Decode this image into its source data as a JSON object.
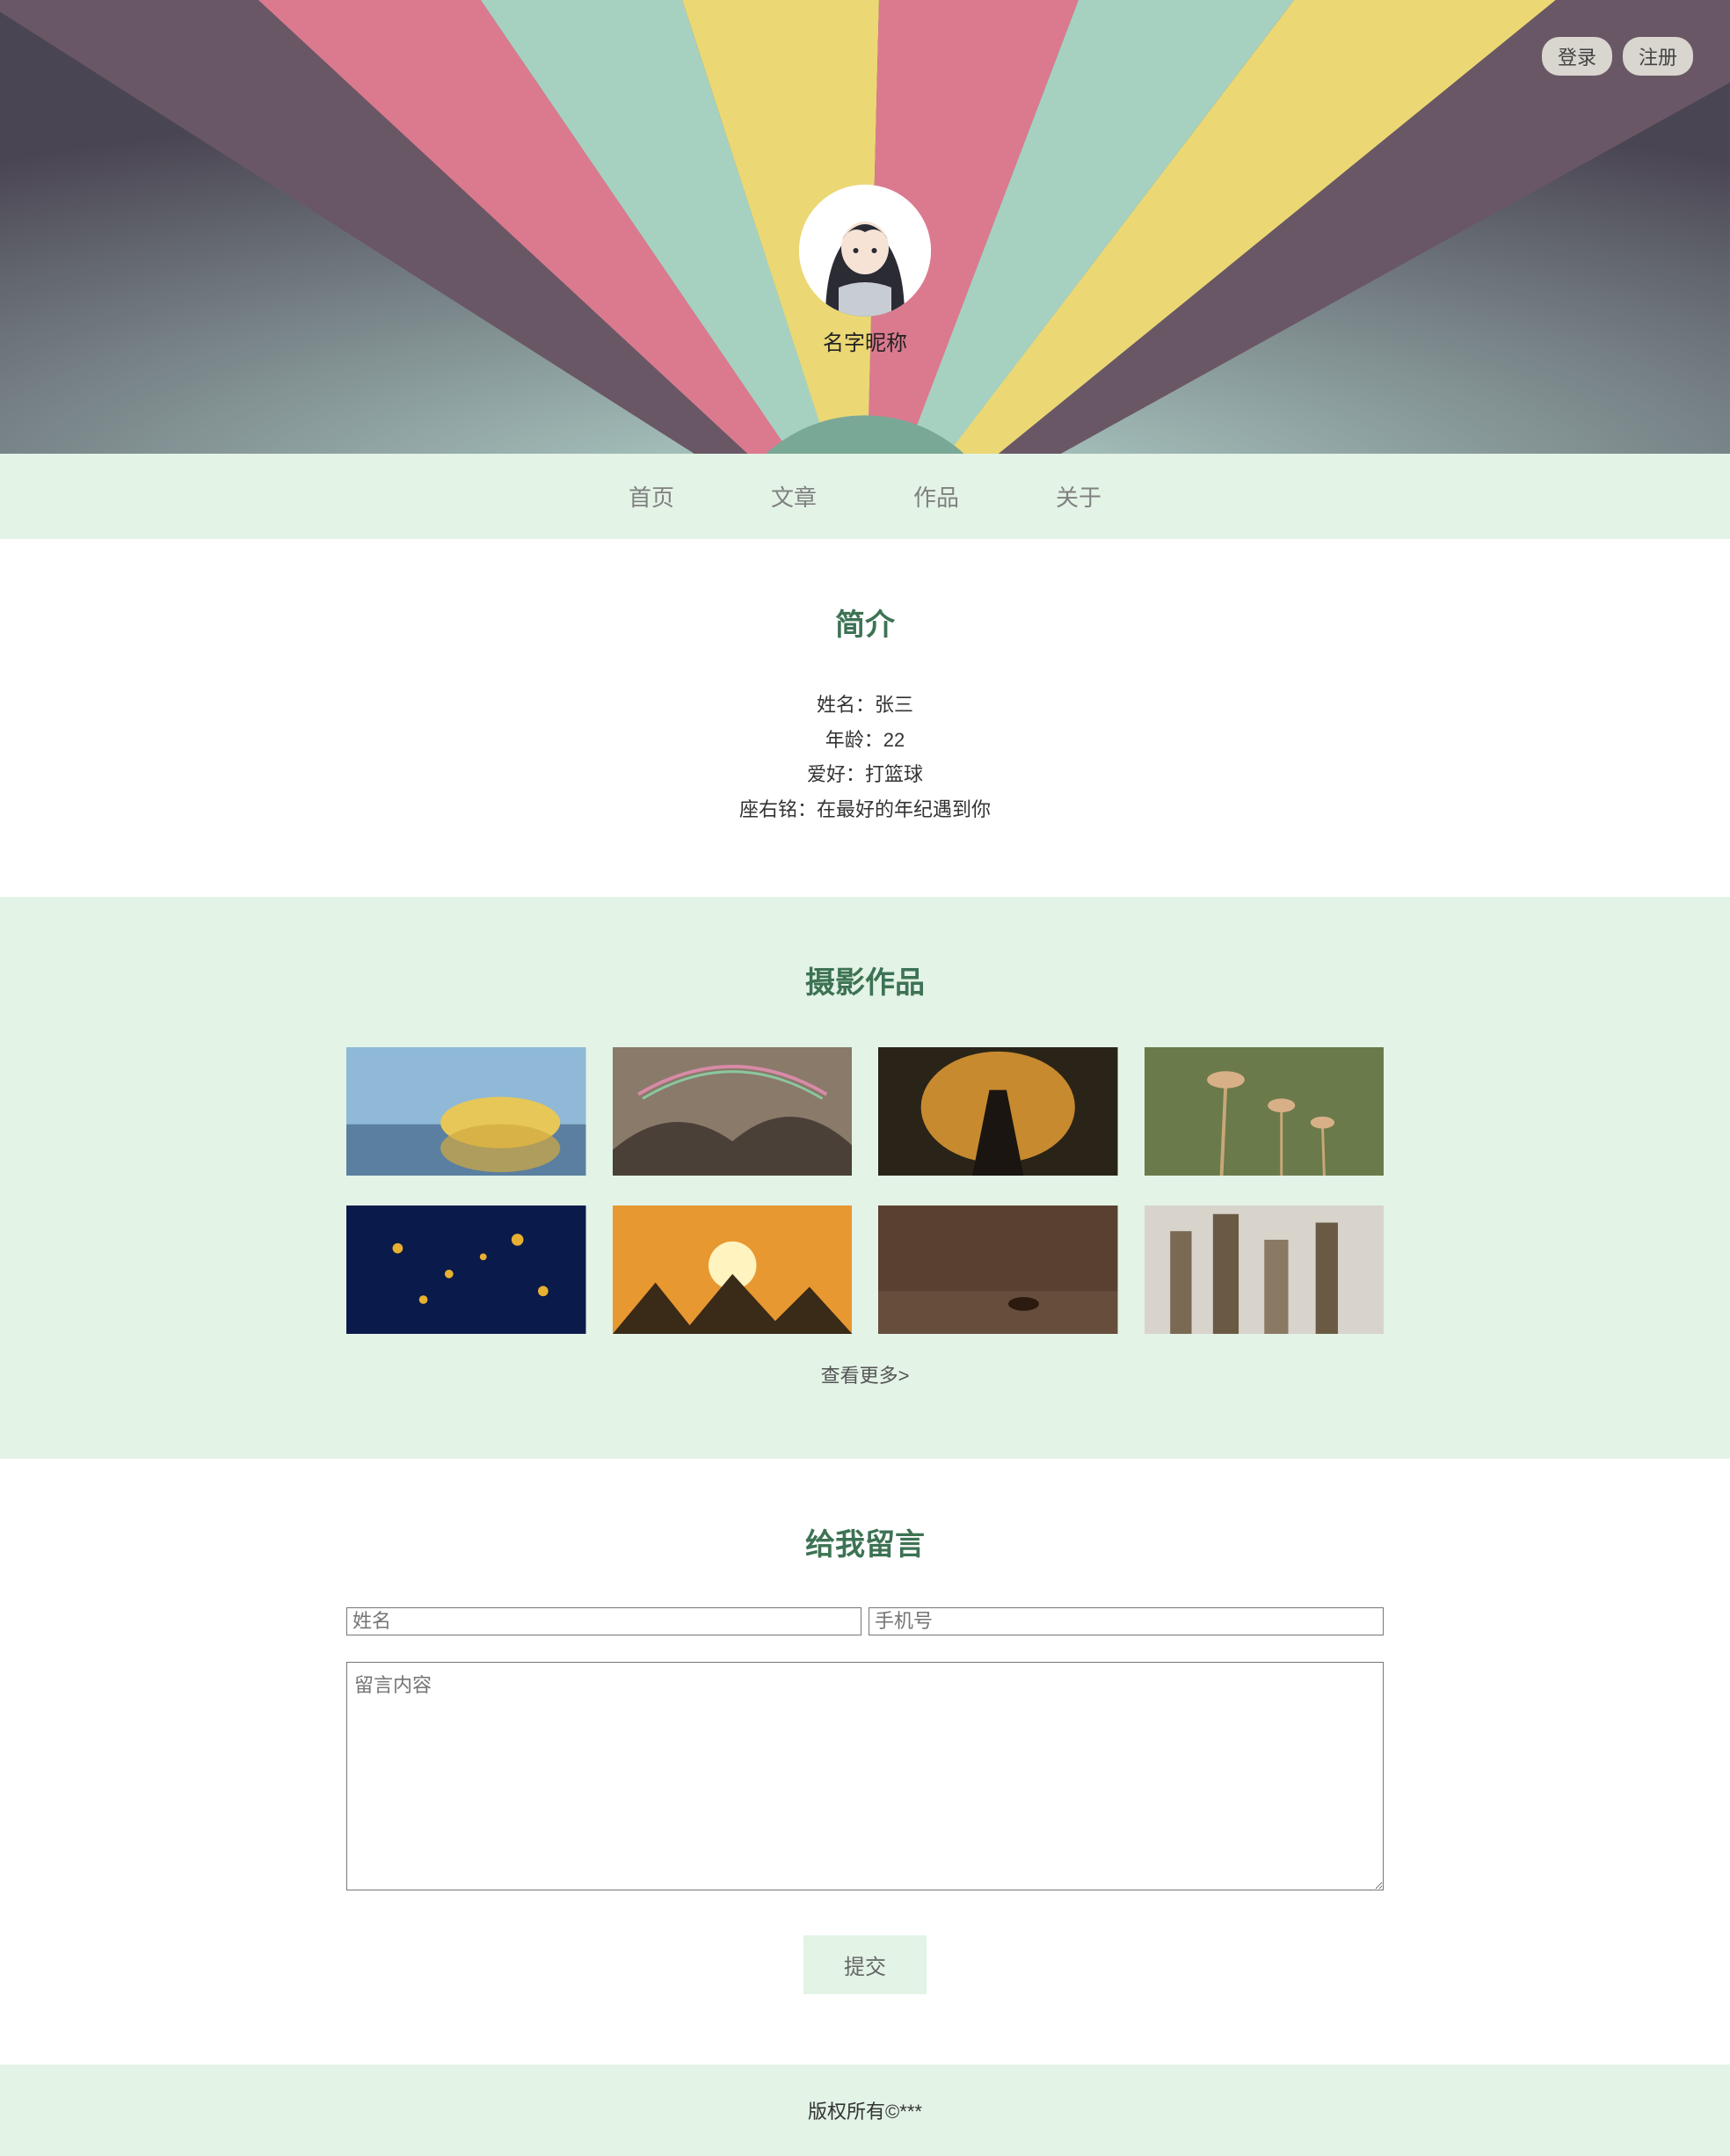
{
  "auth": {
    "login": "登录",
    "register": "注册"
  },
  "profile": {
    "nickname": "名字昵称"
  },
  "nav": {
    "home": "首页",
    "articles": "文章",
    "works": "作品",
    "about": "关于"
  },
  "intro": {
    "title": "简介",
    "name": "姓名：张三",
    "age": "年龄：22",
    "hobby": "爱好：打篮球",
    "motto": "座右铭：在最好的年纪遇到你"
  },
  "works": {
    "title": "摄影作品",
    "more": "查看更多>"
  },
  "contact": {
    "title": "给我留言",
    "name_placeholder": "姓名",
    "phone_placeholder": "手机号",
    "msg_placeholder": "留言内容",
    "submit": "提交"
  },
  "footer": {
    "copyright": "版权所有©***"
  }
}
